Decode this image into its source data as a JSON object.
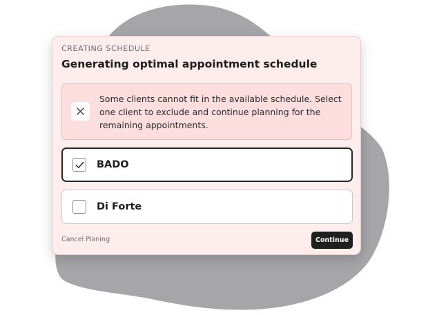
{
  "colors": {
    "backdrop_blob": "#a6a6a8",
    "modal_background": "#fdeeed",
    "alert_background": "#fbdedd",
    "alert_border": "#f1bcbb",
    "button_background": "#1f1f1f",
    "text_primary": "#1d1d1d"
  },
  "modal": {
    "eyebrow": "CREATING SCHEDULE",
    "title": "Generating optimal appointment schedule",
    "alert": {
      "icon": "close-icon",
      "message": "Some clients cannot fit in the available schedule. Select one client to exclude and continue planning for the remaining appointments."
    },
    "options": [
      {
        "label": "BADO",
        "checked": true
      },
      {
        "label": "Di Forte",
        "checked": false
      }
    ],
    "footer": {
      "cancel_label": "Cancel Planing",
      "continue_label": "Continue"
    }
  }
}
